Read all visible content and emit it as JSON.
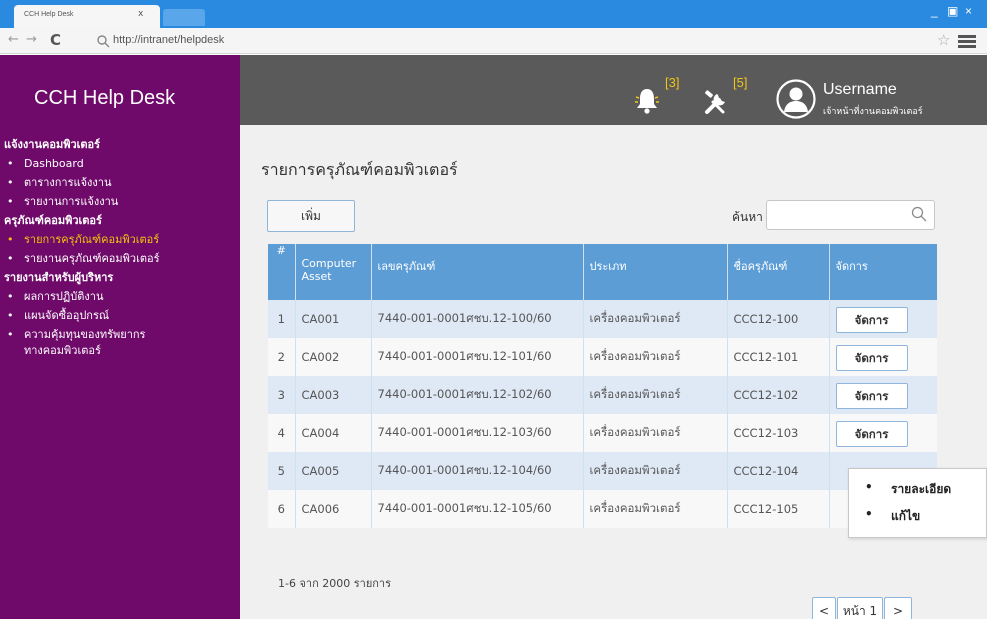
{
  "browser": {
    "tab_title": "CCH Help Desk",
    "tab_close": "x",
    "url": "http://intranet/helpdesk",
    "window_controls": [
      "_",
      "▣",
      "×"
    ]
  },
  "app": {
    "title": "CCH Help Desk",
    "notifications_count": "[3]",
    "repairs_count": "[5]",
    "username": "Username",
    "user_role": "เจ้าหน้าที่งานคอมพิวเตอร์"
  },
  "sidebar": {
    "sections": [
      {
        "title": "แจ้งงานคอมพิวเตอร์",
        "items": [
          {
            "label": "Dashboard",
            "active": false
          },
          {
            "label": "ตารางการแจ้งงาน",
            "active": false
          },
          {
            "label": "รายงานการแจ้งงาน",
            "active": false
          }
        ]
      },
      {
        "title": "ครุภัณฑ์คอมพิวเตอร์",
        "items": [
          {
            "label": "รายการครุภัณฑ์คอมพิวเตอร์",
            "active": true
          },
          {
            "label": "รายงานครุภัณฑ์คอมพิวเตอร์",
            "active": false
          }
        ]
      },
      {
        "title": "รายงานสำหรับผู้บริหาร",
        "items": [
          {
            "label": "ผลการปฏิบัติงาน",
            "active": false
          },
          {
            "label": "แผนจัดซื้ออุปกรณ์",
            "active": false
          },
          {
            "label": "ความคุ้มทุนของทรัพยากร",
            "label2": "ทางคอมพิวเตอร์",
            "active": false
          }
        ]
      }
    ]
  },
  "main": {
    "page_title": "รายการครุภัณฑ์คอมพิวเตอร์",
    "add_button": "เพิ่ม",
    "search_label": "ค้นหา",
    "search_value": "",
    "table": {
      "headers": [
        "#",
        "Computer Asset",
        "เลขครุภัณฑ์",
        "ประเภท",
        "ชื่อครุภัณฑ์",
        "จัดการ"
      ],
      "rows": [
        {
          "num": "1",
          "asset": "CA001",
          "code": "7440-001-0001ศชบ.12-100/60",
          "type": "เครื่องคอมพิวเตอร์",
          "name": "CCC12-100",
          "action": "จัดการ"
        },
        {
          "num": "2",
          "asset": "CA002",
          "code": "7440-001-0001ศชบ.12-101/60",
          "type": "เครื่องคอมพิวเตอร์",
          "name": "CCC12-101",
          "action": "จัดการ"
        },
        {
          "num": "3",
          "asset": "CA003",
          "code": "7440-001-0001ศชบ.12-102/60",
          "type": "เครื่องคอมพิวเตอร์",
          "name": "CCC12-102",
          "action": "จัดการ"
        },
        {
          "num": "4",
          "asset": "CA004",
          "code": "7440-001-0001ศชบ.12-103/60",
          "type": "เครื่องคอมพิวเตอร์",
          "name": "CCC12-103",
          "action": "จัดการ"
        },
        {
          "num": "5",
          "asset": "CA005",
          "code": "7440-001-0001ศชบ.12-104/60",
          "type": "เครื่องคอมพิวเตอร์",
          "name": "CCC12-104",
          "action": ""
        },
        {
          "num": "6",
          "asset": "CA006",
          "code": "7440-001-0001ศชบ.12-105/60",
          "type": "เครื่องคอมพิวเตอร์",
          "name": "CCC12-105",
          "action": ""
        }
      ]
    },
    "action_menu": [
      "รายละเอียด",
      "แก้ไข"
    ],
    "record_summary": "1-6 จาก 2000 รายการ",
    "pagination": {
      "prev": "<",
      "page": "หน้า 1",
      "next": ">"
    }
  },
  "colors": {
    "sidebar": "#6f0a6a",
    "topbar": "#5a5a5a",
    "active_menu": "#f3c20e",
    "table_header": "#5d9dd6",
    "browser_bar": "#2a8ae0"
  }
}
